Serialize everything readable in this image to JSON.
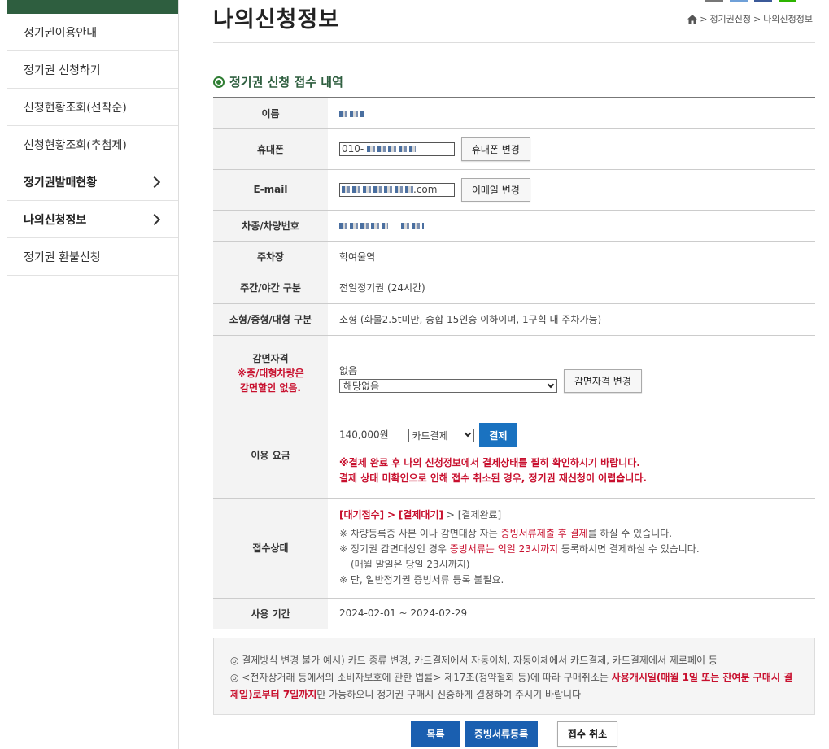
{
  "sidebar": {
    "items": [
      {
        "label": "정기권이용안내",
        "bold": false,
        "chevron": false
      },
      {
        "label": "정기권 신청하기",
        "bold": false,
        "chevron": false
      },
      {
        "label": "신청현황조회(선착순)",
        "bold": false,
        "chevron": false
      },
      {
        "label": "신청현황조회(추첨제)",
        "bold": false,
        "chevron": false
      },
      {
        "label": "정기권발매현황",
        "bold": true,
        "chevron": true
      },
      {
        "label": "나의신청정보",
        "bold": true,
        "chevron": true
      },
      {
        "label": "정기권 환불신청",
        "bold": false,
        "chevron": false
      }
    ]
  },
  "header": {
    "title": "나의신청정보",
    "breadcrumb": [
      "정기권신청",
      "나의신청정보"
    ]
  },
  "section": {
    "title": "정기권 신청 접수 내역"
  },
  "rows": {
    "name": {
      "label": "이름"
    },
    "phone": {
      "label": "휴대폰",
      "value_prefix": "010-",
      "button": "휴대폰 변경"
    },
    "email": {
      "label": "E-mail",
      "value_suffix": ".com",
      "button": "이메일 변경"
    },
    "vehicle": {
      "label": "차종/차량번호"
    },
    "parking": {
      "label": "주차장",
      "value": "학여울역"
    },
    "daynight": {
      "label": "주간/야간 구분",
      "value": "전일정기권 (24시간)"
    },
    "size": {
      "label": "소형/중형/대형 구분",
      "value": "소형 (화물2.5t미만, 승합 15인승 이하이며, 1구획 내 주차가능)"
    },
    "exempt": {
      "label": "감면자격",
      "note1": "※중/대형차량은",
      "note2": "감면할인 없음.",
      "value": "없음",
      "select": "해당없음",
      "button": "감면자격 변경"
    },
    "fee": {
      "label": "이용 요금",
      "amount": "140,000원",
      "method": "카드결제",
      "button": "결제",
      "warn1": "※결제 완료 후 나의 신청정보에서 결제상태를 필히 확인하시기 바랍니다.",
      "warn2": "결제 상태 미확인으로 인해 접수 취소된 경우, 정기권 재신청이 어렵습니다."
    },
    "status": {
      "label": "접수상태",
      "step1": "[대기접수]",
      "step2": "[결제대기]",
      "step3": "[결제완료]",
      "line1_a": "※ 차량등록증 사본 이나 감면대상 자는 ",
      "line1_b": "증빙서류제출 후 결제",
      "line1_c": "를 하실 수 있습니다.",
      "line2_a": "※ 정기권 감면대상인 경우 ",
      "line2_b": "증빙서류는 익일 23시까지",
      "line2_c": " 등록하시면 결제하실 수 있습니다.",
      "line3": "(매월 말일은 당일 23시까지)",
      "line4": "※ 단, 일반정기권 증빙서류 등록 불필요."
    },
    "period": {
      "label": "사용 기간",
      "value": "2024-02-01 ~ 2024-02-29"
    }
  },
  "notice": {
    "line1": "◎ 결제방식 변경 불가 예시) 카드 종류 변경, 카드결제에서 자동이체, 자동이체에서 카드결제, 카드결제에서 제로페이 등",
    "line2_a": "◎ <전자상거래 등에서의 소비자보호에 관한 법률> 제17조(청약철회 등)에 따라 구매취소는 ",
    "line2_b": "사용개시일(매월 1일 또는 잔여분 구매시 결제일)로부터 7일까지",
    "line2_c": "만 가능하오니 정기권 구매시 신중하게 결정하여 주시기 바랍니다"
  },
  "buttons": {
    "list": "목록",
    "upload": "증빙서류등록",
    "cancel": "접수 취소"
  },
  "colors": {
    "brand_green": "#2e5e3f",
    "button_blue": "#1a72c0",
    "warning_red": "#c8102e"
  }
}
